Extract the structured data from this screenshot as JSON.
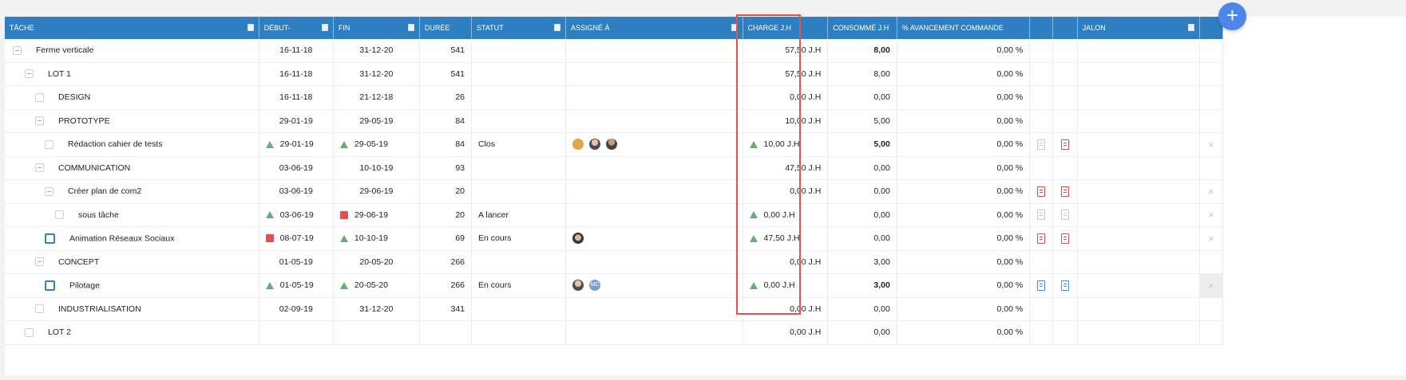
{
  "columns": {
    "tache": "TÂCHE",
    "debut": "DÉBUT-",
    "fin": "FIN",
    "duree": "DURÉE",
    "statut": "STATUT",
    "assigne": "ASSIGNÉ À",
    "charge": "CHARGE J.H",
    "consomme": "CONSOMMÉ J.H",
    "avancement": "% AVANCEMENT COMMANDE",
    "jalon": "JALON"
  },
  "rows": [
    {
      "name": "Ferme verticale",
      "debut": "16-11-18",
      "fin": "31-12-20",
      "duree": "541",
      "statut": "",
      "charge": "57,50 J.H",
      "consomme": "8,00",
      "avancement": "0,00 %"
    },
    {
      "name": "LOT 1",
      "debut": "16-11-18",
      "fin": "31-12-20",
      "duree": "541",
      "statut": "",
      "charge": "57,50 J.H",
      "consomme": "8,00",
      "avancement": "0,00 %"
    },
    {
      "name": "DESIGN",
      "debut": "16-11-18",
      "fin": "21-12-18",
      "duree": "26",
      "statut": "",
      "charge": "0,00 J.H",
      "consomme": "0,00",
      "avancement": "0,00 %"
    },
    {
      "name": "PROTOTYPE",
      "debut": "29-01-19",
      "fin": "29-05-19",
      "duree": "84",
      "statut": "",
      "charge": "10,00 J.H",
      "consomme": "5,00",
      "avancement": "0,00 %"
    },
    {
      "name": "Rédaction cahier de tests",
      "debut": "29-01-19",
      "fin": "29-05-19",
      "duree": "84",
      "statut": "Clos",
      "charge": "10,00 J.H",
      "consomme": "5,00",
      "avancement": "0,00 %"
    },
    {
      "name": "COMMUNICATION",
      "debut": "03-06-19",
      "fin": "10-10-19",
      "duree": "93",
      "statut": "",
      "charge": "47,50 J.H",
      "consomme": "0,00",
      "avancement": "0,00 %"
    },
    {
      "name": "Créer plan de com2",
      "debut": "03-06-19",
      "fin": "29-06-19",
      "duree": "20",
      "statut": "",
      "charge": "0,00 J.H",
      "consomme": "0,00",
      "avancement": "0,00 %"
    },
    {
      "name": "sous tâche",
      "debut": "03-06-19",
      "fin": "29-06-19",
      "duree": "20",
      "statut": "A lancer",
      "charge": "0,00 J.H",
      "consomme": "0,00",
      "avancement": "0,00 %"
    },
    {
      "name": "Animation Réseaux Sociaux",
      "debut": "08-07-19",
      "fin": "10-10-19",
      "duree": "69",
      "statut": "En cours",
      "charge": "47,50 J.H",
      "consomme": "0,00",
      "avancement": "0,00 %"
    },
    {
      "name": "CONCEPT",
      "debut": "01-05-19",
      "fin": "20-05-20",
      "duree": "266",
      "statut": "",
      "charge": "0,00 J.H",
      "consomme": "3,00",
      "avancement": "0,00 %"
    },
    {
      "name": "Pilotage",
      "debut": "01-05-19",
      "fin": "20-05-20",
      "duree": "266",
      "statut": "En cours",
      "charge": "0,00 J.H",
      "consomme": "3,00",
      "avancement": "0,00 %"
    },
    {
      "name": "INDUSTRIALISATION",
      "debut": "02-09-19",
      "fin": "31-12-20",
      "duree": "341",
      "statut": "",
      "charge": "0,00 J.H",
      "consomme": "0,00",
      "avancement": "0,00 %"
    },
    {
      "name": "LOT 2",
      "debut": "",
      "fin": "",
      "duree": "",
      "statut": "",
      "charge": "0,00 J.H",
      "consomme": "0,00",
      "avancement": "0,00 %"
    }
  ],
  "avatars": {
    "mc_initials": "MC"
  },
  "fab_label": "+",
  "close_glyph": "×",
  "colors": {
    "header": "#2e7fc1",
    "highlight_border": "#e3534e",
    "on_track": "#6bab74",
    "late": "#e65050",
    "fab": "#4d86e8"
  }
}
